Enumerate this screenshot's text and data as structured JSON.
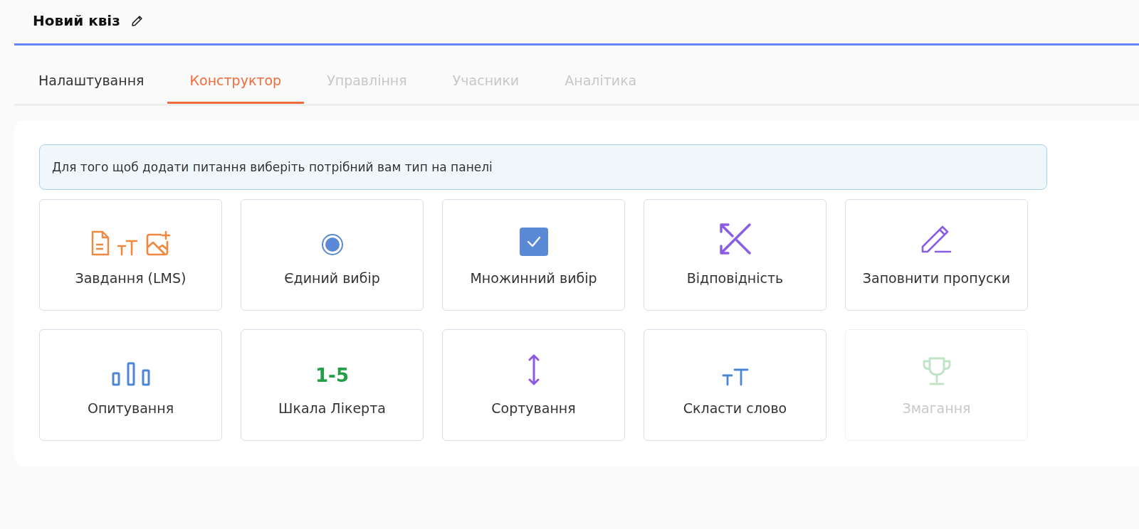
{
  "header": {
    "title": "Новий квіз"
  },
  "tabs": [
    {
      "label": "Налаштування",
      "selected": false,
      "disabled": false
    },
    {
      "label": "Конструктор",
      "selected": true,
      "disabled": false
    },
    {
      "label": "Управління",
      "selected": false,
      "disabled": true
    },
    {
      "label": "Учасники",
      "selected": false,
      "disabled": true
    },
    {
      "label": "Аналітика",
      "selected": false,
      "disabled": true
    }
  ],
  "notice": "Для того щоб додати питання виберіть потрібний вам тип на панелі",
  "question_types": [
    {
      "kind": "lms",
      "label": "Завдання (LMS)",
      "disabled": false
    },
    {
      "kind": "single",
      "label": "Єдиний вибір",
      "disabled": false
    },
    {
      "kind": "multiple",
      "label": "Множинний вибір",
      "disabled": false
    },
    {
      "kind": "matching",
      "label": "Відповідність",
      "disabled": false
    },
    {
      "kind": "fill",
      "label": "Заповнити пропуски",
      "disabled": false
    },
    {
      "kind": "poll",
      "label": "Опитування",
      "disabled": false
    },
    {
      "kind": "likert",
      "icon_text": "1-5",
      "label": "Шкала Лікерта",
      "disabled": false
    },
    {
      "kind": "sorting",
      "label": "Сортування",
      "disabled": false
    },
    {
      "kind": "word",
      "label": "Скласти слово",
      "disabled": false
    },
    {
      "kind": "contest",
      "label": "Змагання",
      "disabled": true
    }
  ]
}
